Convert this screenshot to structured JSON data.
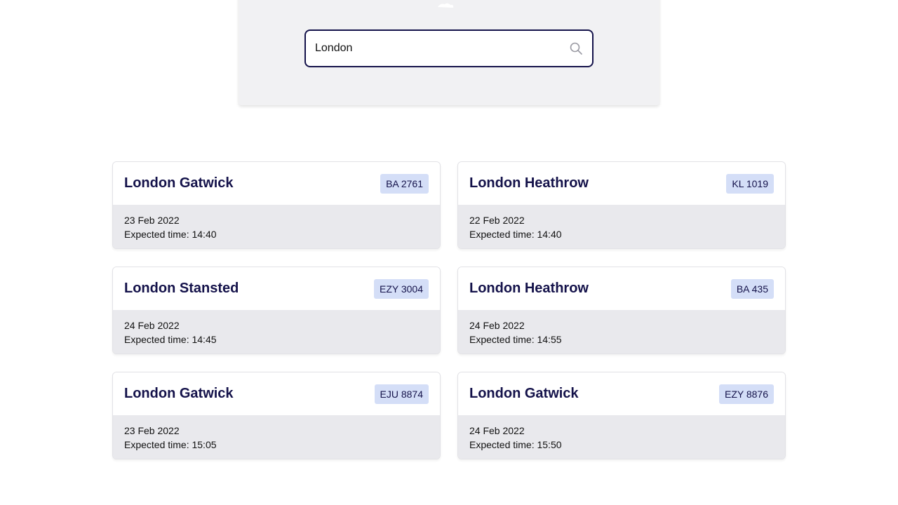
{
  "search": {
    "value": "London",
    "icon": "search-icon"
  },
  "colors": {
    "accent": "#14124a",
    "badge_bg": "#d4def7",
    "card_body_bg": "#e9e9ed",
    "hero_bg": "#f1f1f3"
  },
  "results": [
    {
      "airport": "London Gatwick",
      "flight": "BA 2761",
      "date": "23 Feb 2022",
      "expected": "Expected time: 14:40"
    },
    {
      "airport": "London Heathrow",
      "flight": "KL 1019",
      "date": "22 Feb 2022",
      "expected": "Expected time: 14:40"
    },
    {
      "airport": "London Stansted",
      "flight": "EZY 3004",
      "date": "24 Feb 2022",
      "expected": "Expected time: 14:45"
    },
    {
      "airport": "London Heathrow",
      "flight": "BA 435",
      "date": "24 Feb 2022",
      "expected": "Expected time: 14:55"
    },
    {
      "airport": "London Gatwick",
      "flight": "EJU 8874",
      "date": "23 Feb 2022",
      "expected": "Expected time: 15:05"
    },
    {
      "airport": "London Gatwick",
      "flight": "EZY 8876",
      "date": "24 Feb 2022",
      "expected": "Expected time: 15:50"
    }
  ]
}
